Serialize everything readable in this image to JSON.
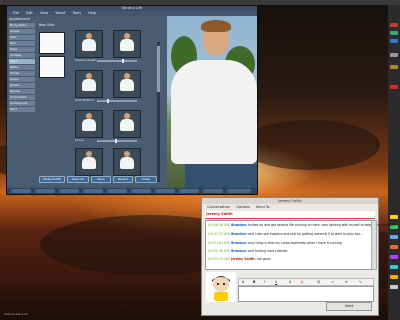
{
  "colors": {
    "accent": "#3b6a9c",
    "chat_name": "#cc1111",
    "chat_nick": "#1155cc"
  },
  "sl": {
    "title": "Second Life",
    "menu": [
      "File",
      "Edit",
      "View",
      "World",
      "Tools",
      "Help"
    ],
    "panel_title": "Appearance",
    "panel_list": [
      "Body Parts",
      "Shape",
      "Skin",
      "Hair",
      "Eyes",
      "Clothes",
      "Shirt",
      "Pants",
      "Shoes",
      "Socks",
      "Jacket",
      "Gloves",
      "Undershirt",
      "Underpants",
      "Skirt"
    ],
    "sub_head": "New Shirt",
    "caption_sleeve": "Sleeve Length",
    "caption_loose": "Shirt Bottom",
    "caption_tight": "Loose",
    "caption_fit": "Shirt Fit",
    "btn_make_outfit": "Make Outfit",
    "btn_save_all": "Save All",
    "btn_save": "Save",
    "btn_close": "Close",
    "btn_revert": "Revert",
    "bottom_btns": [
      "Chat",
      "Friends",
      "Groups",
      "Fly",
      "Snapshot",
      "Search",
      "Build",
      "Map",
      "Mini-Map",
      "Inventory"
    ]
  },
  "chat": {
    "title": "Jeremy Smith",
    "menu": [
      "Conversation",
      "Options",
      "Send To"
    ],
    "to": "Jeremy Smith",
    "messages": [
      {
        "time": "(03:46:38 AM)",
        "nick": "Brandon:",
        "text": "fucked up and got second life running on here. now fighting with myself to keep from playing it"
      },
      {
        "time": "(03:47:22 AM)",
        "nick": "Brandon:",
        "text": "and i don see how/bro and shit for getting warcraft 3 to work to play too..."
      },
      {
        "time": "(03:51:03 AM)",
        "nick": "Brandon:",
        "text": "only thing is that my comp overheats when i have it running"
      },
      {
        "time": "(03:52:36 AM)",
        "nick": "Brandon:",
        "text": "and fucking hard crashes"
      },
      {
        "time": "(03:53:25 AM)",
        "nick2": "Jeremy Smith:",
        "text": "not good"
      }
    ],
    "toolbar": [
      "A",
      "B",
      "I",
      "U",
      "A",
      "A",
      "☺",
      "↗",
      "✉",
      "✎"
    ],
    "send_label": "Send"
  },
  "watermark": "sl-linux-ssb.com"
}
